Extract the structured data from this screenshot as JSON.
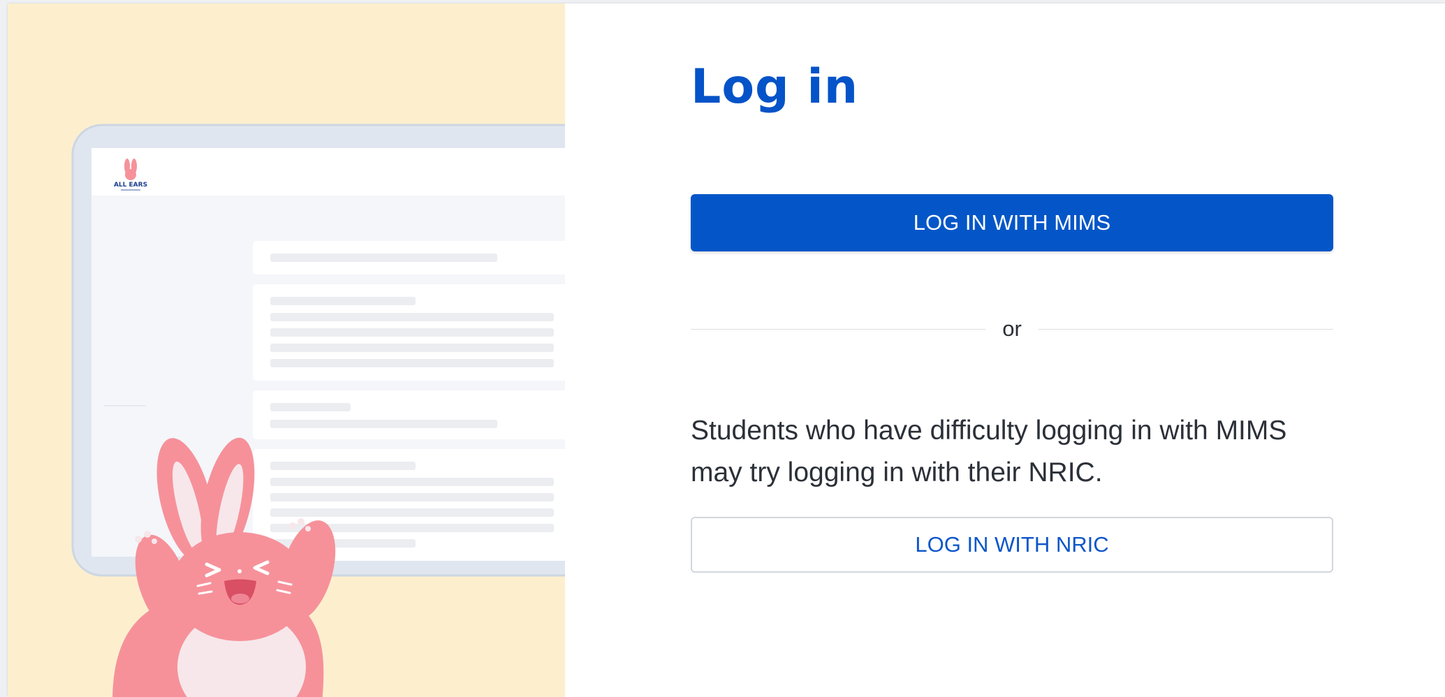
{
  "illustration": {
    "logo_text": "ALL EARS"
  },
  "login": {
    "title": "Log in",
    "mims_button_label": "LOG IN WITH MIMS",
    "divider_text": "or",
    "help_text": "Students who have difficulty logging in with MIMS may try logging in with their NRIC.",
    "nric_button_label": "LOG IN WITH NRIC"
  },
  "colors": {
    "brand_blue": "#0456c8",
    "illustration_background": "#fdefce",
    "bunny_pink": "#f6919a"
  }
}
